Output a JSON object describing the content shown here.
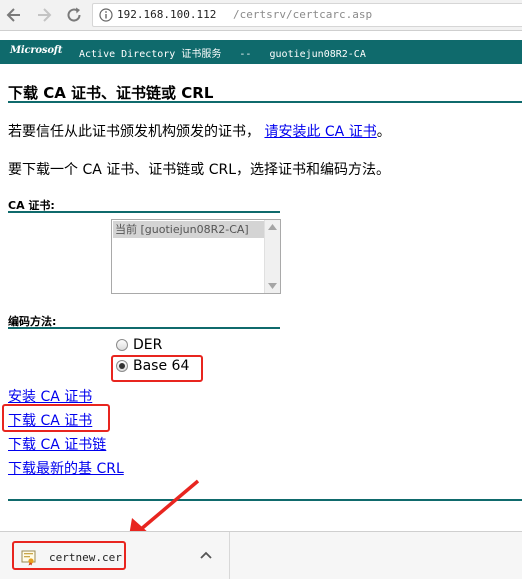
{
  "browser": {
    "url_host": "192.168.100.112",
    "url_path": "/certsrv/certcarc.asp"
  },
  "header": {
    "logo": "Microsoft",
    "text": "Active Directory 证书服务   --   guotiejun08R2-CA"
  },
  "page": {
    "title": "下载 CA 证书、证书链或 CRL",
    "trust_text": "若要信任从此证书颁发机构颁发的证书，",
    "trust_link": "请安装此 CA 证书",
    "trust_end": "。",
    "instruction": "要下载一个 CA 证书、证书链或 CRL，选择证书和编码方法。",
    "ca_label": "CA 证书:",
    "ca_options": [
      "当前 [guotiejun08R2-CA]"
    ],
    "encoding_label": "编码方法:",
    "encoding_options": [
      "DER",
      "Base 64"
    ],
    "encoding_selected": "Base 64",
    "links": [
      "安装 CA 证书",
      "下载 CA 证书",
      "下载 CA 证书链",
      "下载最新的基 CRL"
    ]
  },
  "downloads": {
    "file_name": "certnew.cer"
  },
  "colors": {
    "accent": "#0f6a6c",
    "highlight": "#e8251f",
    "link": "#0000ee"
  }
}
